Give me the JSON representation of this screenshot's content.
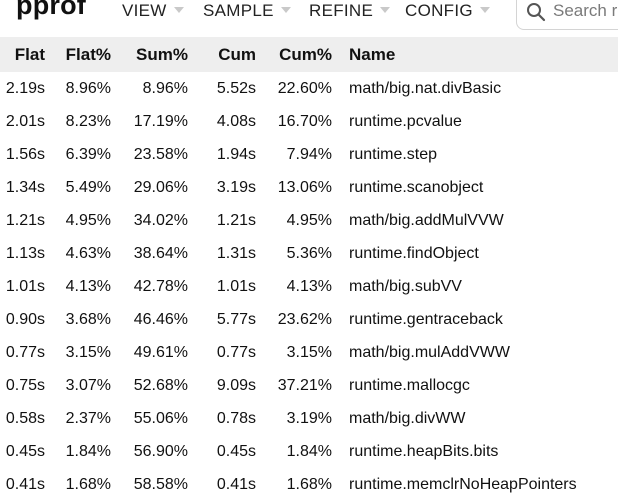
{
  "app": {
    "logo": "pprof"
  },
  "menu": {
    "view": "VIEW",
    "sample": "SAMPLE",
    "refine": "REFINE",
    "config": "CONFIG"
  },
  "search": {
    "placeholder": "Search regexp"
  },
  "table": {
    "headers": {
      "flat": "Flat",
      "flat_pct": "Flat%",
      "sum_pct": "Sum%",
      "cum": "Cum",
      "cum_pct": "Cum%",
      "name": "Name"
    },
    "rows": [
      {
        "flat": "2.19s",
        "flat_pct": "8.96%",
        "sum_pct": "8.96%",
        "cum": "5.52s",
        "cum_pct": "22.60%",
        "name": "math/big.nat.divBasic"
      },
      {
        "flat": "2.01s",
        "flat_pct": "8.23%",
        "sum_pct": "17.19%",
        "cum": "4.08s",
        "cum_pct": "16.70%",
        "name": "runtime.pcvalue"
      },
      {
        "flat": "1.56s",
        "flat_pct": "6.39%",
        "sum_pct": "23.58%",
        "cum": "1.94s",
        "cum_pct": "7.94%",
        "name": "runtime.step"
      },
      {
        "flat": "1.34s",
        "flat_pct": "5.49%",
        "sum_pct": "29.06%",
        "cum": "3.19s",
        "cum_pct": "13.06%",
        "name": "runtime.scanobject"
      },
      {
        "flat": "1.21s",
        "flat_pct": "4.95%",
        "sum_pct": "34.02%",
        "cum": "1.21s",
        "cum_pct": "4.95%",
        "name": "math/big.addMulVVW"
      },
      {
        "flat": "1.13s",
        "flat_pct": "4.63%",
        "sum_pct": "38.64%",
        "cum": "1.31s",
        "cum_pct": "5.36%",
        "name": "runtime.findObject"
      },
      {
        "flat": "1.01s",
        "flat_pct": "4.13%",
        "sum_pct": "42.78%",
        "cum": "1.01s",
        "cum_pct": "4.13%",
        "name": "math/big.subVV"
      },
      {
        "flat": "0.90s",
        "flat_pct": "3.68%",
        "sum_pct": "46.46%",
        "cum": "5.77s",
        "cum_pct": "23.62%",
        "name": "runtime.gentraceback"
      },
      {
        "flat": "0.77s",
        "flat_pct": "3.15%",
        "sum_pct": "49.61%",
        "cum": "0.77s",
        "cum_pct": "3.15%",
        "name": "math/big.mulAddVWW"
      },
      {
        "flat": "0.75s",
        "flat_pct": "3.07%",
        "sum_pct": "52.68%",
        "cum": "9.09s",
        "cum_pct": "37.21%",
        "name": "runtime.mallocgc"
      },
      {
        "flat": "0.58s",
        "flat_pct": "2.37%",
        "sum_pct": "55.06%",
        "cum": "0.78s",
        "cum_pct": "3.19%",
        "name": "math/big.divWW"
      },
      {
        "flat": "0.45s",
        "flat_pct": "1.84%",
        "sum_pct": "56.90%",
        "cum": "0.45s",
        "cum_pct": "1.84%",
        "name": "runtime.heapBits.bits"
      },
      {
        "flat": "0.41s",
        "flat_pct": "1.68%",
        "sum_pct": "58.58%",
        "cum": "0.41s",
        "cum_pct": "1.68%",
        "name": "runtime.memclrNoHeapPointers"
      }
    ]
  },
  "icons": {
    "search": "search-icon",
    "menu_caret": "caret-down-icon"
  },
  "colors": {
    "header_row_bg": "#eeeeee",
    "caret": "#c9c9c9",
    "text": "#111111"
  }
}
